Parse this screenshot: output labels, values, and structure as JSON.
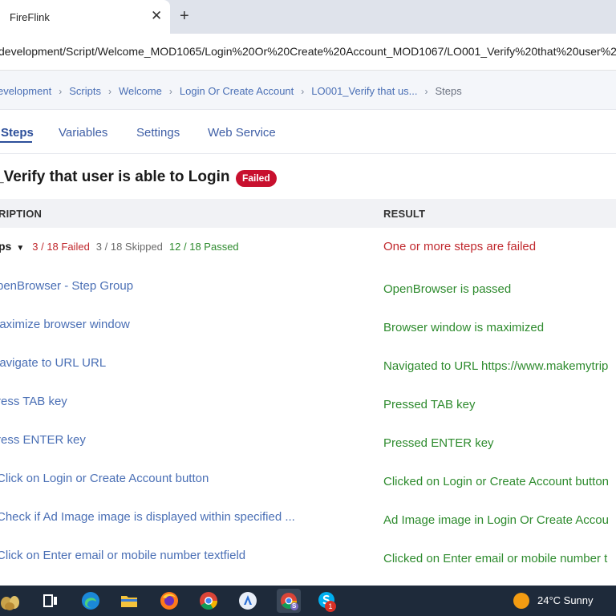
{
  "browser": {
    "tab_title": "FireFlink",
    "tab_close": "✕",
    "new_tab": "+",
    "url": "development/Script/Welcome_MOD1065/Login%20Or%20Create%20Account_MOD1067/LO001_Verify%20that%20user%20is"
  },
  "breadcrumb": {
    "items": [
      "evelopment",
      "Scripts",
      "Welcome",
      "Login Or Create Account",
      "LO001_Verify that us...",
      "Steps"
    ],
    "separator": "›"
  },
  "tabs": [
    "Steps",
    "Variables",
    "Settings",
    "Web Service"
  ],
  "title": {
    "text": "_Verify that user is able to Login",
    "status": "Failed"
  },
  "table": {
    "headers": [
      "RIPTION",
      "RESULT"
    ],
    "summary": {
      "label": "ps",
      "caret": "▼",
      "failed": "3 / 18 Failed",
      "skipped": "3 / 18 Skipped",
      "passed": "12 / 18 Passed",
      "result": "One or more steps are failed"
    },
    "rows": [
      {
        "desc": "penBrowser - Step Group",
        "result": "OpenBrowser is passed"
      },
      {
        "desc": "laximize browser window",
        "result": "Browser window is maximized"
      },
      {
        "desc": "lavigate to URL URL",
        "result": "Navigated to URL https://www.makemytrip"
      },
      {
        "desc": "ress TAB key",
        "result": "Pressed TAB key"
      },
      {
        "desc": "ress ENTER key",
        "result": "Pressed ENTER key"
      },
      {
        "desc": "Click on Login or Create Account button",
        "result": "Clicked on Login or Create Account button"
      },
      {
        "desc": "Check if Ad Image image is displayed within specified ...",
        "result": "Ad Image image in Login Or Create Accou"
      },
      {
        "desc": "Click on Enter email or mobile number textfield",
        "result": "Clicked on Enter email or mobile number t"
      }
    ]
  },
  "taskbar": {
    "weather": "24°C  Sunny",
    "icons": [
      "explorer-plants-icon",
      "task-view-icon",
      "edge-icon",
      "file-explorer-icon",
      "firefox-icon",
      "chrome-icon",
      "appstore-icon",
      "chrome-profile-icon",
      "skype-icon",
      "weather-sun-icon"
    ],
    "skype_badge": "1",
    "profile_badge": "S"
  },
  "colors": {
    "accent": "#4a6fb5",
    "failed": "#c0282d",
    "passed": "#2e8b2e",
    "badge": "#c8102e"
  }
}
